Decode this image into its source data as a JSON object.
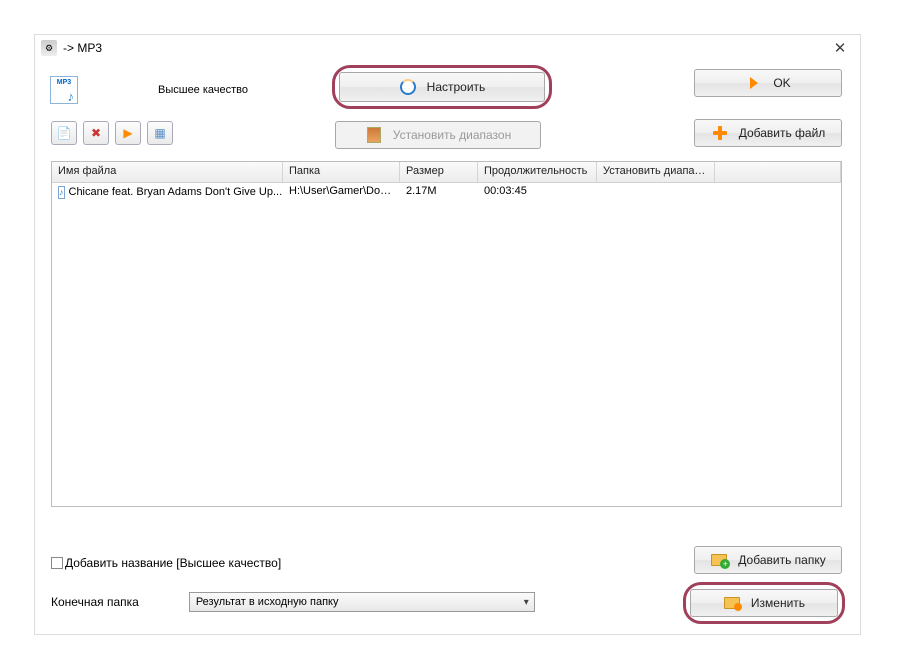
{
  "window": {
    "title": "-> MP3"
  },
  "topbar": {
    "mp3_label": "MP3",
    "quality_label": "Высшее качество",
    "configure_label": "Настроить",
    "ok_label": "OK",
    "addfile_label": "Добавить файл",
    "range_label": "Установить диапазон"
  },
  "table": {
    "columns": [
      "Имя файла",
      "Папка",
      "Размер",
      "Продолжительность",
      "Установить диапаз...",
      ""
    ],
    "rows": [
      {
        "filename": "Chicane feat. Bryan Adams Don't Give Up....",
        "folder": "H:\\User\\Gamer\\Doc...",
        "size": "2.17M",
        "duration": "00:03:45",
        "range": ""
      }
    ]
  },
  "bottom": {
    "addname_label": "Добавить название [Высшее качество]",
    "addfolder_label": "Добавить папку",
    "destfolder_label": "Конечная папка",
    "dest_value": "Результат в исходную папку",
    "change_label": "Изменить"
  }
}
